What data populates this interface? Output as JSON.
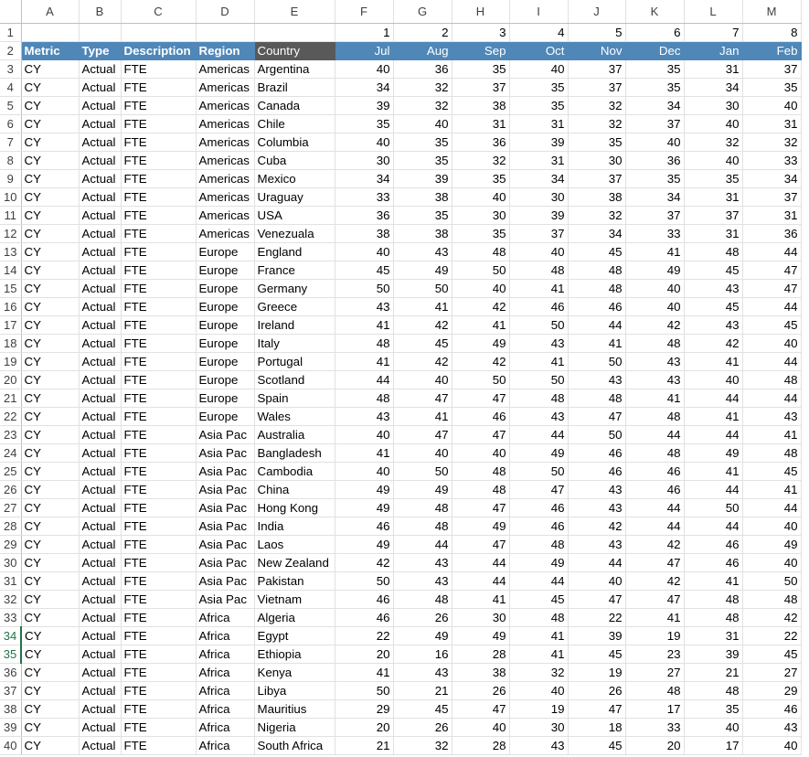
{
  "columns": [
    "A",
    "B",
    "C",
    "D",
    "E",
    "F",
    "G",
    "H",
    "I",
    "J",
    "K",
    "L",
    "M"
  ],
  "row1": [
    "",
    "",
    "",
    "",
    "",
    "1",
    "2",
    "3",
    "4",
    "5",
    "6",
    "7",
    "8"
  ],
  "headers": [
    "Metric",
    "Type",
    "Description",
    "Region",
    "Country",
    "Jul",
    "Aug",
    "Sep",
    "Oct",
    "Nov",
    "Dec",
    "Jan",
    "Feb"
  ],
  "rows": [
    [
      "CY",
      "Actual",
      "FTE",
      "Americas",
      "Argentina",
      "40",
      "36",
      "35",
      "40",
      "37",
      "35",
      "31",
      "37"
    ],
    [
      "CY",
      "Actual",
      "FTE",
      "Americas",
      "Brazil",
      "34",
      "32",
      "37",
      "35",
      "37",
      "35",
      "34",
      "35"
    ],
    [
      "CY",
      "Actual",
      "FTE",
      "Americas",
      "Canada",
      "39",
      "32",
      "38",
      "35",
      "32",
      "34",
      "30",
      "40"
    ],
    [
      "CY",
      "Actual",
      "FTE",
      "Americas",
      "Chile",
      "35",
      "40",
      "31",
      "31",
      "32",
      "37",
      "40",
      "31"
    ],
    [
      "CY",
      "Actual",
      "FTE",
      "Americas",
      "Columbia",
      "40",
      "35",
      "36",
      "39",
      "35",
      "40",
      "32",
      "32"
    ],
    [
      "CY",
      "Actual",
      "FTE",
      "Americas",
      "Cuba",
      "30",
      "35",
      "32",
      "31",
      "30",
      "36",
      "40",
      "33"
    ],
    [
      "CY",
      "Actual",
      "FTE",
      "Americas",
      "Mexico",
      "34",
      "39",
      "35",
      "34",
      "37",
      "35",
      "35",
      "34"
    ],
    [
      "CY",
      "Actual",
      "FTE",
      "Americas",
      "Uraguay",
      "33",
      "38",
      "40",
      "30",
      "38",
      "34",
      "31",
      "37"
    ],
    [
      "CY",
      "Actual",
      "FTE",
      "Americas",
      "USA",
      "36",
      "35",
      "30",
      "39",
      "32",
      "37",
      "37",
      "31"
    ],
    [
      "CY",
      "Actual",
      "FTE",
      "Americas",
      "Venezuala",
      "38",
      "38",
      "35",
      "37",
      "34",
      "33",
      "31",
      "36"
    ],
    [
      "CY",
      "Actual",
      "FTE",
      "Europe",
      "England",
      "40",
      "43",
      "48",
      "40",
      "45",
      "41",
      "48",
      "44"
    ],
    [
      "CY",
      "Actual",
      "FTE",
      "Europe",
      "France",
      "45",
      "49",
      "50",
      "48",
      "48",
      "49",
      "45",
      "47"
    ],
    [
      "CY",
      "Actual",
      "FTE",
      "Europe",
      "Germany",
      "50",
      "50",
      "40",
      "41",
      "48",
      "40",
      "43",
      "47"
    ],
    [
      "CY",
      "Actual",
      "FTE",
      "Europe",
      "Greece",
      "43",
      "41",
      "42",
      "46",
      "46",
      "40",
      "45",
      "44"
    ],
    [
      "CY",
      "Actual",
      "FTE",
      "Europe",
      "Ireland",
      "41",
      "42",
      "41",
      "50",
      "44",
      "42",
      "43",
      "45"
    ],
    [
      "CY",
      "Actual",
      "FTE",
      "Europe",
      "Italy",
      "48",
      "45",
      "49",
      "43",
      "41",
      "48",
      "42",
      "40"
    ],
    [
      "CY",
      "Actual",
      "FTE",
      "Europe",
      "Portugal",
      "41",
      "42",
      "42",
      "41",
      "50",
      "43",
      "41",
      "44"
    ],
    [
      "CY",
      "Actual",
      "FTE",
      "Europe",
      "Scotland",
      "44",
      "40",
      "50",
      "50",
      "43",
      "43",
      "40",
      "48"
    ],
    [
      "CY",
      "Actual",
      "FTE",
      "Europe",
      "Spain",
      "48",
      "47",
      "47",
      "48",
      "48",
      "41",
      "44",
      "44"
    ],
    [
      "CY",
      "Actual",
      "FTE",
      "Europe",
      "Wales",
      "43",
      "41",
      "46",
      "43",
      "47",
      "48",
      "41",
      "43"
    ],
    [
      "CY",
      "Actual",
      "FTE",
      "Asia Pac",
      "Australia",
      "40",
      "47",
      "47",
      "44",
      "50",
      "44",
      "44",
      "41"
    ],
    [
      "CY",
      "Actual",
      "FTE",
      "Asia Pac",
      "Bangladesh",
      "41",
      "40",
      "40",
      "49",
      "46",
      "48",
      "49",
      "48"
    ],
    [
      "CY",
      "Actual",
      "FTE",
      "Asia Pac",
      "Cambodia",
      "40",
      "50",
      "48",
      "50",
      "46",
      "46",
      "41",
      "45"
    ],
    [
      "CY",
      "Actual",
      "FTE",
      "Asia Pac",
      "China",
      "49",
      "49",
      "48",
      "47",
      "43",
      "46",
      "44",
      "41"
    ],
    [
      "CY",
      "Actual",
      "FTE",
      "Asia Pac",
      "Hong Kong",
      "49",
      "48",
      "47",
      "46",
      "43",
      "44",
      "50",
      "44"
    ],
    [
      "CY",
      "Actual",
      "FTE",
      "Asia Pac",
      "India",
      "46",
      "48",
      "49",
      "46",
      "42",
      "44",
      "44",
      "40"
    ],
    [
      "CY",
      "Actual",
      "FTE",
      "Asia Pac",
      "Laos",
      "49",
      "44",
      "47",
      "48",
      "43",
      "42",
      "46",
      "49"
    ],
    [
      "CY",
      "Actual",
      "FTE",
      "Asia Pac",
      "New Zealand",
      "42",
      "43",
      "44",
      "49",
      "44",
      "47",
      "46",
      "40"
    ],
    [
      "CY",
      "Actual",
      "FTE",
      "Asia Pac",
      "Pakistan",
      "50",
      "43",
      "44",
      "44",
      "40",
      "42",
      "41",
      "50"
    ],
    [
      "CY",
      "Actual",
      "FTE",
      "Asia Pac",
      "Vietnam",
      "46",
      "48",
      "41",
      "45",
      "47",
      "47",
      "48",
      "48"
    ],
    [
      "CY",
      "Actual",
      "FTE",
      "Africa",
      "Algeria",
      "46",
      "26",
      "30",
      "48",
      "22",
      "41",
      "48",
      "42"
    ],
    [
      "CY",
      "Actual",
      "FTE",
      "Africa",
      "Egypt",
      "22",
      "49",
      "49",
      "41",
      "39",
      "19",
      "31",
      "22"
    ],
    [
      "CY",
      "Actual",
      "FTE",
      "Africa",
      "Ethiopia",
      "20",
      "16",
      "28",
      "41",
      "45",
      "23",
      "39",
      "45"
    ],
    [
      "CY",
      "Actual",
      "FTE",
      "Africa",
      "Kenya",
      "41",
      "43",
      "38",
      "32",
      "19",
      "27",
      "21",
      "27"
    ],
    [
      "CY",
      "Actual",
      "FTE",
      "Africa",
      "Libya",
      "50",
      "21",
      "26",
      "40",
      "26",
      "48",
      "48",
      "29"
    ],
    [
      "CY",
      "Actual",
      "FTE",
      "Africa",
      "Mauritius",
      "29",
      "45",
      "47",
      "19",
      "47",
      "17",
      "35",
      "46"
    ],
    [
      "CY",
      "Actual",
      "FTE",
      "Africa",
      "Nigeria",
      "20",
      "26",
      "40",
      "30",
      "18",
      "33",
      "40",
      "43"
    ],
    [
      "CY",
      "Actual",
      "FTE",
      "Africa",
      "South Africa",
      "21",
      "32",
      "28",
      "43",
      "45",
      "20",
      "17",
      "40"
    ]
  ],
  "selected_rows": [
    34,
    35
  ],
  "colors": {
    "header_blue": "#4f87b8",
    "header_dark": "#595959",
    "selection_green": "#217346"
  }
}
